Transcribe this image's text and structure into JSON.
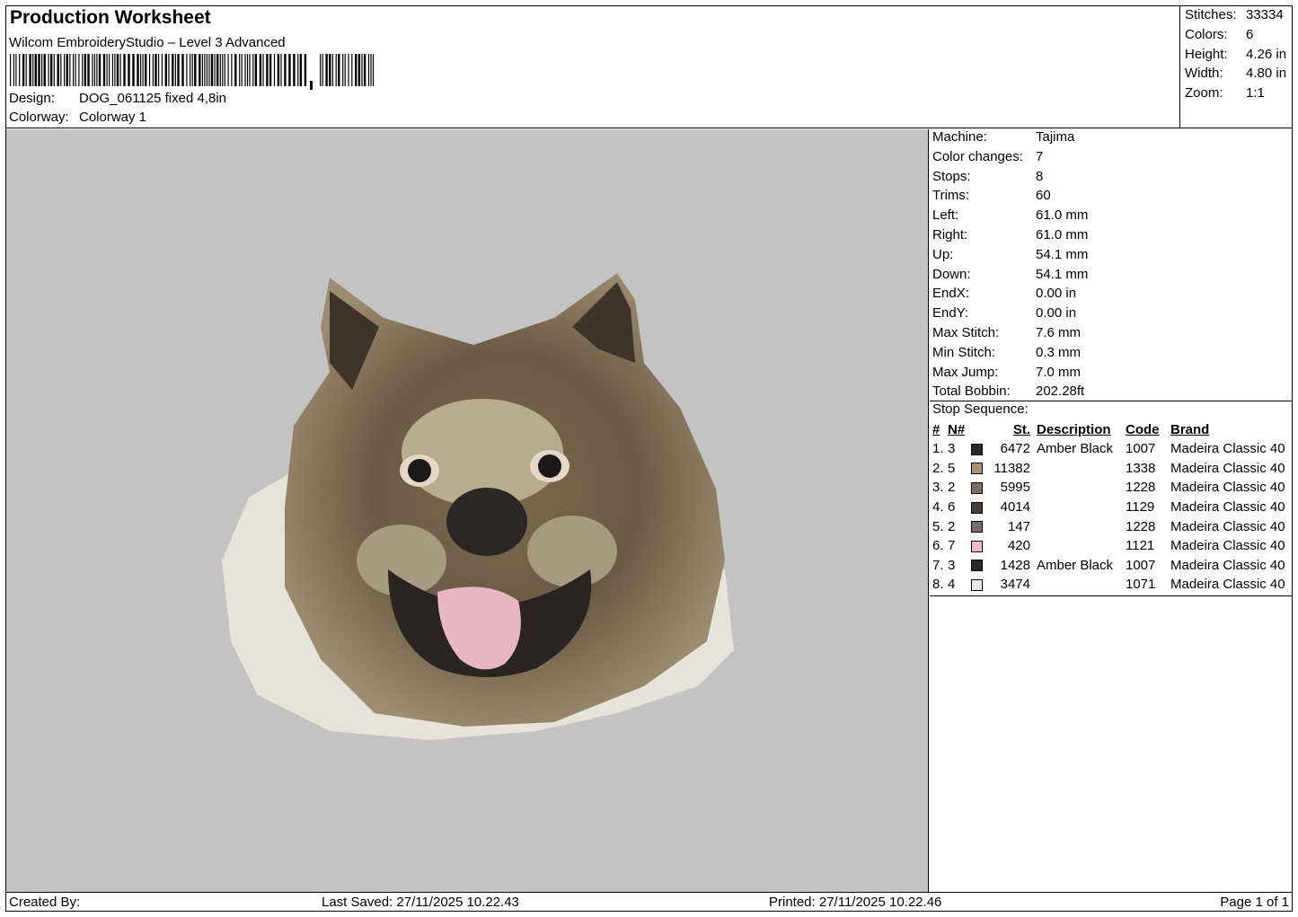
{
  "header": {
    "title": "Production Worksheet",
    "software": "Wilcom EmbroideryStudio – Level 3 Advanced",
    "design_label": "Design:",
    "design_value": "DOG_061125 fixed 4,8in",
    "colorway_label": "Colorway:",
    "colorway_value": "Colorway 1"
  },
  "summary": [
    {
      "label": "Stitches:",
      "value": "33334"
    },
    {
      "label": "Colors:",
      "value": "6"
    },
    {
      "label": "Height:",
      "value": "4.26 in"
    },
    {
      "label": "Width:",
      "value": "4.80 in"
    },
    {
      "label": "Zoom:",
      "value": "1:1"
    }
  ],
  "machine_info": [
    {
      "label": "Machine:",
      "value": "Tajima"
    },
    {
      "label": "Color changes:",
      "value": "7"
    },
    {
      "label": "Stops:",
      "value": "8"
    },
    {
      "label": "Trims:",
      "value": "60"
    },
    {
      "label": "Left:",
      "value": "61.0 mm"
    },
    {
      "label": "Right:",
      "value": "61.0 mm"
    },
    {
      "label": "Up:",
      "value": "54.1 mm"
    },
    {
      "label": "Down:",
      "value": "54.1 mm"
    },
    {
      "label": "EndX:",
      "value": "0.00 in"
    },
    {
      "label": "EndY:",
      "value": "0.00 in"
    },
    {
      "label": "Max Stitch:",
      "value": "7.6 mm"
    },
    {
      "label": "Min Stitch:",
      "value": "0.3 mm"
    },
    {
      "label": "Max Jump:",
      "value": "7.0 mm"
    },
    {
      "label": "Total Bobbin:",
      "value": "202.28ft"
    }
  ],
  "stop_sequence": {
    "title": "Stop Sequence:",
    "headers": {
      "num": "#",
      "needle": "N#",
      "stitches": "St.",
      "description": "Description",
      "code": "Code",
      "brand": "Brand"
    },
    "rows": [
      {
        "num": "1.",
        "needle": "3",
        "color": "#2a2a2a",
        "stitches": "6472",
        "description": "Amber Black",
        "code": "1007",
        "brand": "Madeira Classic 40"
      },
      {
        "num": "2.",
        "needle": "5",
        "color": "#a8906e",
        "stitches": "11382",
        "description": "",
        "code": "1338",
        "brand": "Madeira Classic 40"
      },
      {
        "num": "3.",
        "needle": "2",
        "color": "#7a6e64",
        "stitches": "5995",
        "description": "",
        "code": "1228",
        "brand": "Madeira Classic 40"
      },
      {
        "num": "4.",
        "needle": "6",
        "color": "#4a3e36",
        "stitches": "4014",
        "description": "",
        "code": "1129",
        "brand": "Madeira Classic 40"
      },
      {
        "num": "5.",
        "needle": "2",
        "color": "#7a6e64",
        "stitches": "147",
        "description": "",
        "code": "1228",
        "brand": "Madeira Classic 40"
      },
      {
        "num": "6.",
        "needle": "7",
        "color": "#f0b8c8",
        "stitches": "420",
        "description": "",
        "code": "1121",
        "brand": "Madeira Classic 40"
      },
      {
        "num": "7.",
        "needle": "3",
        "color": "#2a2a2a",
        "stitches": "1428",
        "description": "Amber Black",
        "code": "1007",
        "brand": "Madeira Classic 40"
      },
      {
        "num": "8.",
        "needle": "4",
        "color": "#e8e6e2",
        "stitches": "3474",
        "description": "",
        "code": "1071",
        "brand": "Madeira Classic 40"
      }
    ]
  },
  "footer": {
    "created_by": "Created By:",
    "last_saved": "Last Saved: 27/11/2025 10.22.43",
    "printed": "Printed: 27/11/2025 10.22.46",
    "page": "Page 1 of 1"
  }
}
